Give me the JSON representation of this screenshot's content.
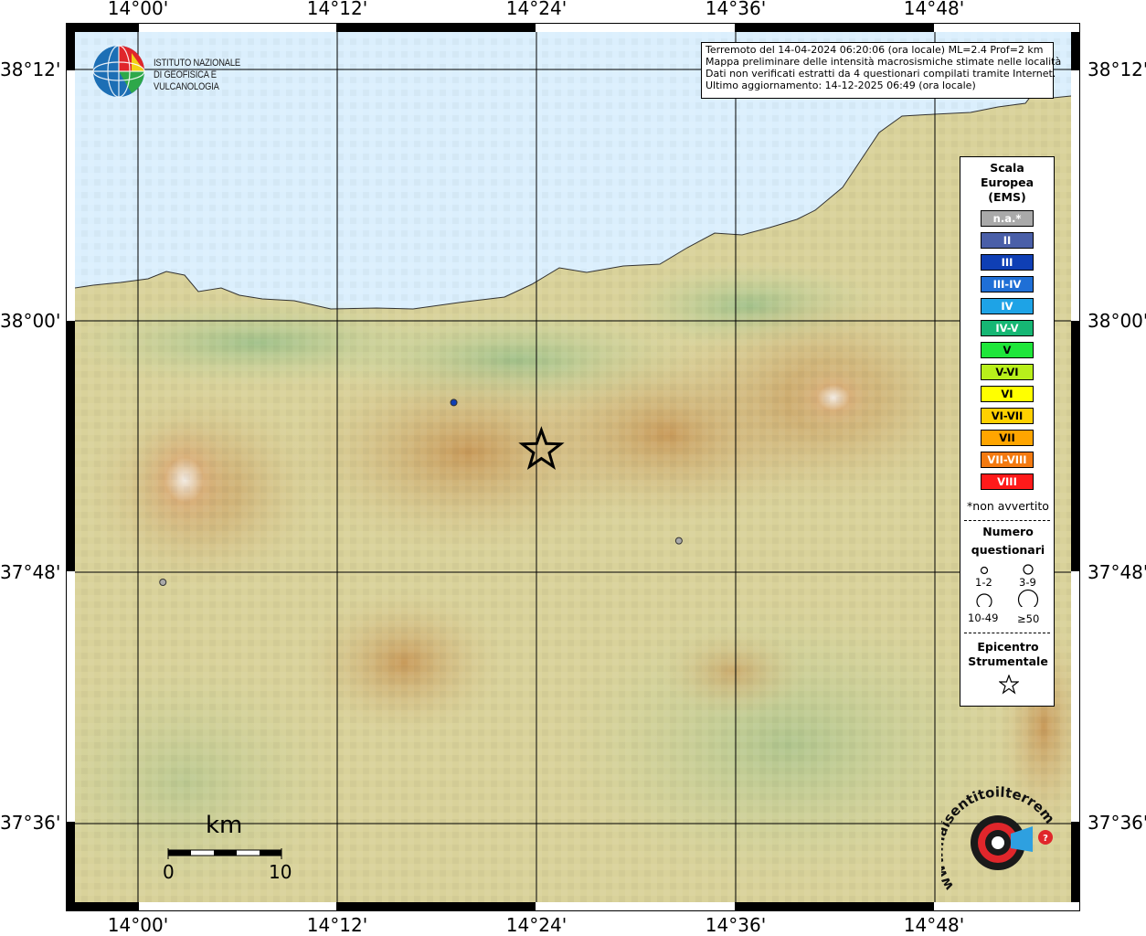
{
  "header": {
    "title_line1": "Terremoto del 14-04-2024 06:20:06 (ora locale) ML=2.4 Prof=2 km",
    "title_line2": "Mappa preliminare delle intensità macrosismiche stimate nelle località",
    "title_line3": "Dati non verificati estratti da 4 questionari compilati tramite Internet.",
    "title_line4": "Ultimo aggiornamento: 14-12-2025 06:49 (ora locale)"
  },
  "institute": {
    "line1": "ISTITUTO NAZIONALE",
    "line2": "DI GEOFISICA E VULCANOLOGIA"
  },
  "axes": {
    "lon_ticks": [
      "14°00'",
      "14°12'",
      "14°24'",
      "14°36'",
      "14°48'"
    ],
    "lat_ticks": [
      "38°12'",
      "38°00'",
      "37°48'",
      "37°36'"
    ]
  },
  "legend": {
    "title_line1": "Scala",
    "title_line2": "Europea",
    "title_line3": "(EMS)",
    "classes": [
      {
        "label": "n.a.*",
        "color": "#a9a9a9"
      },
      {
        "label": "II",
        "color": "#4a5fa8"
      },
      {
        "label": "III",
        "color": "#0f3fb5"
      },
      {
        "label": "III-IV",
        "color": "#1f6fd6"
      },
      {
        "label": "IV",
        "color": "#1ea3e6"
      },
      {
        "label": "IV-V",
        "color": "#16b774"
      },
      {
        "label": "V",
        "color": "#1fe63a"
      },
      {
        "label": "V-VI",
        "color": "#b8ef1b"
      },
      {
        "label": "VI",
        "color": "#ffff00"
      },
      {
        "label": "VI-VII",
        "color": "#ffd000"
      },
      {
        "label": "VII",
        "color": "#ffa500"
      },
      {
        "label": "VII-VIII",
        "color": "#f47a10"
      },
      {
        "label": "VIII",
        "color": "#ff1a1a"
      }
    ],
    "note": "*non avvertito",
    "count_title_line1": "Numero",
    "count_title_line2": "questionari",
    "count_labels": [
      "1-2",
      "3-9",
      "10-49",
      "≥50"
    ],
    "epicenter_line1": "Epicentro",
    "epicenter_line2": "Strumentale"
  },
  "scalebar": {
    "unit": "km",
    "start": "0",
    "end": "10"
  },
  "observations": [
    {
      "lon": 14.317,
      "lat": 37.935,
      "intensity": "III"
    },
    {
      "lon": 14.543,
      "lat": 37.825,
      "intensity": "n.a.*"
    },
    {
      "lon": 14.025,
      "lat": 37.792,
      "intensity": "n.a.*"
    }
  ],
  "epicenter": {
    "lon": 14.405,
    "lat": 37.897
  },
  "watermark": {
    "text": "www.haisentitoilterremoto.it"
  }
}
